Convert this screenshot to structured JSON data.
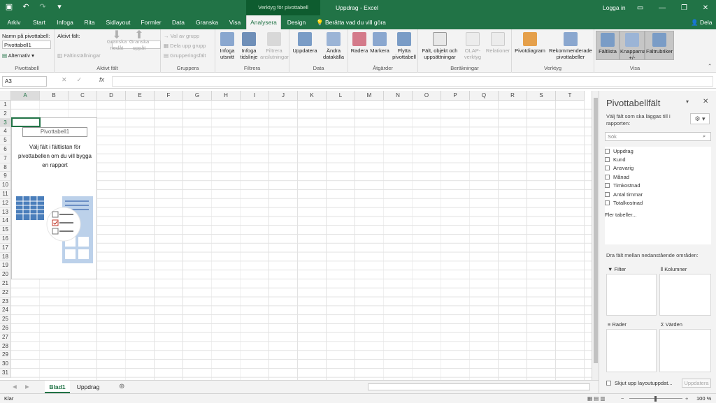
{
  "titlebar": {
    "context_header": "Verktyg för pivottabell",
    "doc_title": "Uppdrag  -  Excel",
    "login": "Logga in"
  },
  "tabs": [
    "Arkiv",
    "Start",
    "Infoga",
    "Rita",
    "Sidlayout",
    "Formler",
    "Data",
    "Granska",
    "Visa",
    "Analysera",
    "Design"
  ],
  "active_tab": "Analysera",
  "tell_me": "Berätta vad du vill göra",
  "share": "Dela",
  "ribbon": {
    "pivottabell": {
      "name_label": "Namn på pivottabell:",
      "name_value": "Pivottabell1",
      "alternativ": "Alternativ",
      "group": "Pivottabell"
    },
    "aktivt_falt": {
      "label": "Aktivt fält:",
      "faltinstallningar": "Fältinställningar",
      "granska_nedat": "Granska nedåt",
      "granska_uppat": "Granska uppåt",
      "group": "Aktivt fält"
    },
    "gruppera": {
      "val_av_grupp": "Val av grupp",
      "dela_upp_grupp": "Dela upp grupp",
      "grupperingsfalt": "Grupperingsfält",
      "group": "Gruppera"
    },
    "filtrera": {
      "infoga_utsnitt": "Infoga utsnitt",
      "infoga_tidslinje": "Infoga tidslinje",
      "filtrera_anslutningar": "Filtrera anslutningar",
      "group": "Filtrera"
    },
    "data": {
      "uppdatera": "Uppdatera",
      "andra_datakalla": "Ändra datakälla",
      "group": "Data"
    },
    "atgarder": {
      "radera": "Radera",
      "markera": "Markera",
      "flytta": "Flytta pivottabell",
      "group": "Åtgärder"
    },
    "berakningar": {
      "falt": "Fält, objekt och uppsättningar",
      "olap": "OLAP-verktyg",
      "relationer": "Relationer",
      "group": "Beräkningar"
    },
    "verktyg": {
      "pivotdiagram": "Pivotdiagram",
      "rekommenderade": "Rekommenderade pivottabeller",
      "group": "Verktyg"
    },
    "visa": {
      "faltlista": "Fältlista",
      "knapparna": "Knapparna +/-",
      "faltrubriker": "Fältrubriker",
      "group": "Visa"
    }
  },
  "formula_bar": {
    "name_box": "A3",
    "fx": "fx",
    "value": ""
  },
  "columns": [
    "A",
    "B",
    "C",
    "D",
    "E",
    "F",
    "G",
    "H",
    "I",
    "J",
    "K",
    "L",
    "M",
    "N",
    "O",
    "P",
    "Q",
    "R",
    "S",
    "T"
  ],
  "rows": [
    "1",
    "2",
    "3",
    "4",
    "5",
    "6",
    "7",
    "8",
    "9",
    "10",
    "11",
    "12",
    "13",
    "14",
    "15",
    "16",
    "17",
    "18",
    "19",
    "20",
    "21",
    "22",
    "23",
    "24",
    "25",
    "26",
    "27",
    "28",
    "29",
    "30",
    "31"
  ],
  "pivot_placeholder": {
    "name": "Pivottabell1",
    "message": "Välj fält i fältlistan för pivottabellen om du vill bygga en rapport"
  },
  "sheets": [
    "Blad1",
    "Uppdrag"
  ],
  "active_sheet": "Blad1",
  "status": {
    "ready": "Klar",
    "zoom": "100 %"
  },
  "field_pane": {
    "title": "Pivottabellfält",
    "subtitle": "Välj fält som ska läggas till i rapporten:",
    "search_placeholder": "Sök",
    "fields": [
      "Uppdrag",
      "Kund",
      "Ansvarig",
      "Månad",
      "Timkostnad",
      "Antal timmar",
      "Totalkostnad"
    ],
    "more_tables": "Fler tabeller...",
    "drag_label": "Dra fält mellan nedanstående områden:",
    "areas": {
      "filter": "Filter",
      "kolumner": "Kolumner",
      "rader": "Rader",
      "varden": "Värden"
    },
    "defer": "Skjut upp layoutuppdat...",
    "update_button": "Uppdatera"
  },
  "colors": {
    "excel_green": "#217346",
    "ribbon_bg": "#f3f3f3",
    "pivot_icon_blue": "#4a7ebb"
  }
}
